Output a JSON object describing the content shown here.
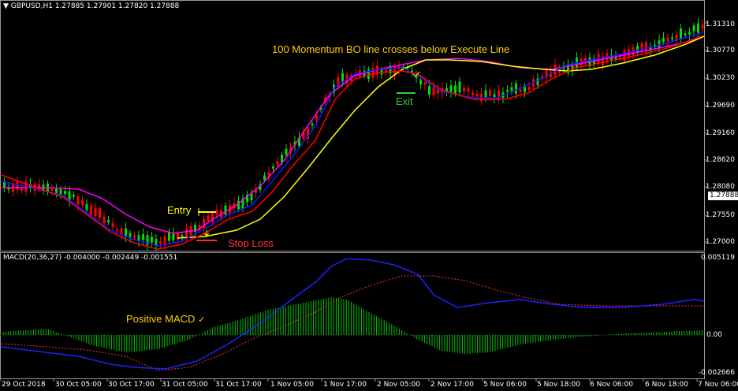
{
  "header": {
    "symbol_line": "GBPUSD,H1  1.27885 1.27901 1.27820 1.27888",
    "macd_line": "MACD(20,36,27) -0.004000 -0.002449 -0.001551"
  },
  "price_axis": {
    "labels": [
      "1.31310",
      "1.30770",
      "1.30230",
      "1.29690",
      "1.29160",
      "1.28620",
      "1.28080",
      "1.27550",
      "1.27000"
    ],
    "current_price": "1.27888"
  },
  "macd_axis": {
    "labels": [
      "0.005119",
      "0.00",
      "-0.002666"
    ]
  },
  "time_axis": {
    "labels": [
      "29 Oct 2018",
      "30 Oct 05:00",
      "30 Oct 17:00",
      "31 Oct 05:00",
      "31 Oct 17:00",
      "1 Nov 05:00",
      "1 Nov 17:00",
      "2 Nov 05:00",
      "2 Nov 17:00",
      "5 Nov 06:00",
      "5 Nov 18:00",
      "6 Nov 06:00",
      "6 Nov 18:00",
      "7 Nov 06:00"
    ]
  },
  "annotations": {
    "headline": "100 Momentum BO line crosses below Execute Line",
    "entry": "Entry",
    "exit": "Exit",
    "stop_loss": "Stop Loss",
    "positive_macd": "Positive MACD",
    "check": "✓"
  },
  "colors": {
    "background": "#000000",
    "bull_candle": "#00e000",
    "bear_candle": "#ff0000",
    "ma_red": "#ff0000",
    "ma_blue": "#1414ff",
    "ma_magenta": "#ff00ff",
    "ma_yellow": "#ffff00",
    "macd_hist": "#00c800",
    "macd_signal": "#ff3030",
    "macd_main": "#2020ff",
    "annotation_yellow": "#ffd000",
    "annotation_red": "#ff3030",
    "annotation_green": "#30d030"
  }
}
